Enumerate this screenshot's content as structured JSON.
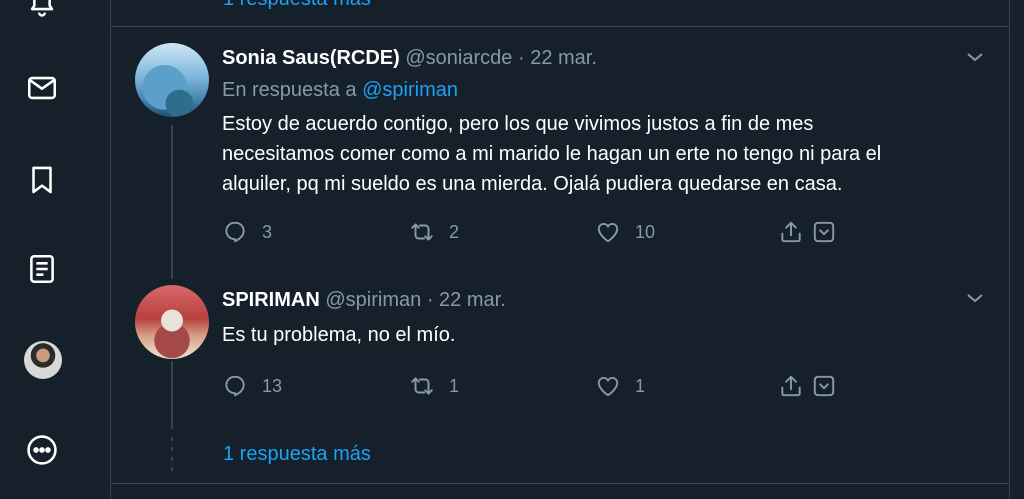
{
  "top_link": "1 respuesta más",
  "tweets": [
    {
      "name": "Sonia Saus(RCDE)",
      "handle": "@soniarcde",
      "separator": "·",
      "date": "22 mar.",
      "reply_prefix": "En respuesta a",
      "reply_mention": "@spiriman",
      "body_lines": [
        "Estoy de acuerdo contigo, pero los que vivimos justos a fin de mes",
        "necesitamos comer como a mi marido le hagan un erte no tengo ni para el",
        "alquiler, pq mi sueldo es una mierda. Ojalá pudiera quedarse en casa."
      ],
      "replies": "3",
      "retweets": "2",
      "likes": "10"
    },
    {
      "name": "SPIRIMAN",
      "handle": "@spiriman",
      "separator": "·",
      "date": "22 mar.",
      "body_lines": [
        "Es tu problema, no el mío."
      ],
      "replies": "13",
      "retweets": "1",
      "likes": "1"
    }
  ],
  "more_replies": "1 respuesta más",
  "icons": {
    "nav": [
      "bell-icon",
      "mail-icon",
      "bookmark-icon",
      "list-icon",
      "profile-avatar",
      "more-icon"
    ],
    "actions": [
      "reply-icon",
      "retweet-icon",
      "like-icon",
      "share-icon",
      "tip-icon"
    ]
  },
  "colors": {
    "background": "#15202b",
    "border": "#38444d",
    "text_primary": "#ffffff",
    "text_secondary": "#8899a6",
    "accent": "#1da1f2"
  }
}
